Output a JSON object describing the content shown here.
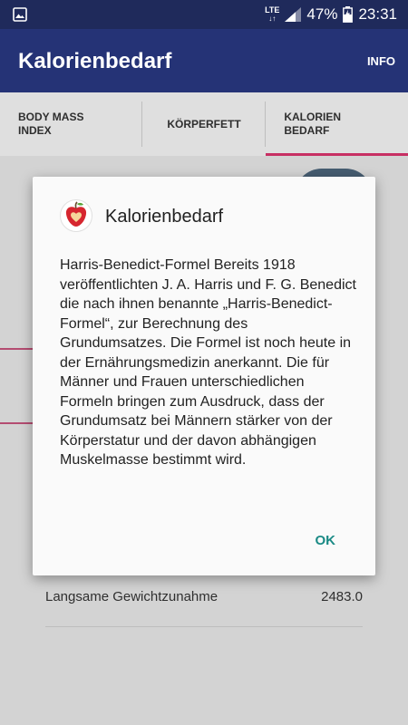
{
  "status_bar": {
    "network": "LTE",
    "battery_percent": "47%",
    "time": "23:31",
    "icons": [
      "image-notification-icon",
      "signal-icon",
      "battery-charging-icon"
    ]
  },
  "app_bar": {
    "title": "Kalorienbedarf",
    "info_label": "INFO"
  },
  "tabs": [
    {
      "label": "BODY MASS INDEX",
      "active": false
    },
    {
      "label": "KÖRPERFETT",
      "active": false
    },
    {
      "label": "KALORIEN BEDARF",
      "active": true
    }
  ],
  "background_list": {
    "row_label": "Langsame Gewichtzunahme",
    "row_value": "2483.0"
  },
  "dialog": {
    "icon": "apple-heart-icon",
    "title": "Kalorienbedarf",
    "body": "Harris-Benedict-Formel Bereits 1918 veröffentlichten J. A. Harris und F. G. Benedict die nach ihnen benannte „Harris-Benedict-Formel“, zur Berechnung des Grundumsatzes. Die Formel ist noch heute in der Ernährungsmedizin anerkannt. Die für Männer und Frauen unterschiedlichen Formeln bringen zum Ausdruck, dass der Grundumsatz bei Männern stärker von der Körperstatur und der davon abhängigen Muskelmasse bestimmt wird.",
    "ok_label": "OK"
  },
  "colors": {
    "status_bar": "#1f2a5b",
    "app_bar": "#253376",
    "tab_indicator": "#d8346c",
    "dialog_button": "#1a8a85"
  }
}
